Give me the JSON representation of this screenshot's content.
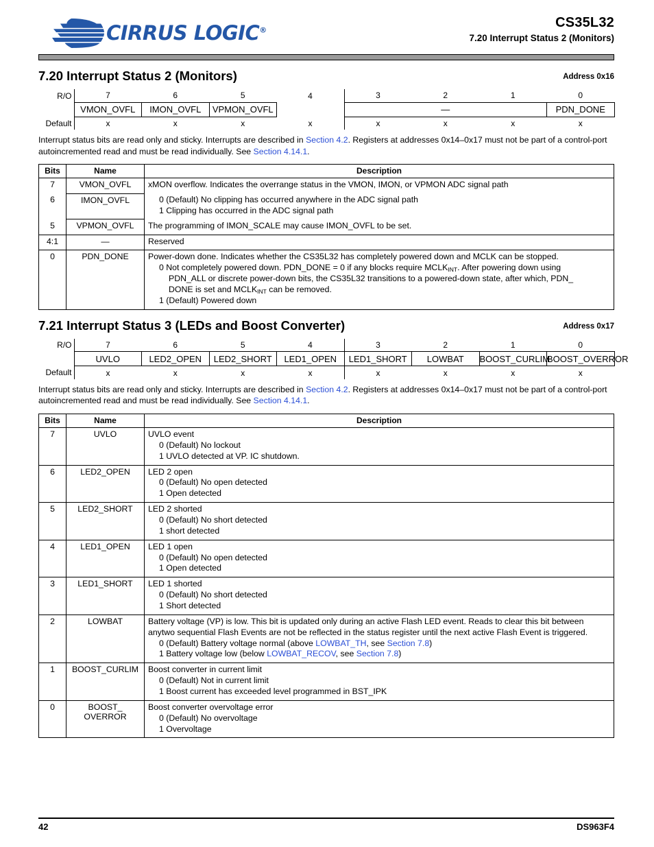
{
  "header": {
    "logo_text": "CIRRUS LOGIC",
    "logo_reg": "®",
    "part_number": "CS35L32",
    "subtitle": "7.20 Interrupt Status 2 (Monitors)",
    "logo_color": "#2457a7"
  },
  "footer": {
    "page_number": "42",
    "doc_number": "DS963F4"
  },
  "sections": [
    {
      "title": "7.20 Interrupt Status 2 (Monitors)",
      "address": "Address 0x16",
      "register": {
        "access_label": "R/O",
        "default_label": "Default",
        "bit_numbers": [
          "7",
          "6",
          "5",
          "4",
          "3",
          "2",
          "1",
          "0"
        ],
        "fields": [
          {
            "label": "VMON_OVFL",
            "span": 1,
            "bordered": true
          },
          {
            "label": "IMON_OVFL",
            "span": 1,
            "bordered": true
          },
          {
            "label": "VPMON_OVFL",
            "span": 1,
            "bordered": true
          },
          {
            "label": "",
            "span": 1,
            "bordered": false
          },
          {
            "label": "—",
            "span": 3,
            "bordered": true
          },
          {
            "label": "PDN_DONE",
            "span": 1,
            "bordered": true
          }
        ],
        "defaults": [
          "x",
          "x",
          "x",
          "x",
          "x",
          "x",
          "x",
          "x"
        ]
      },
      "note": {
        "part1": "Interrupt status bits are read only and sticky. Interrupts are described in ",
        "link1": "Section 4.2",
        "part2": ". Registers at addresses 0x14–0x17 must not be part of a control-port autoincremented read and must be read individually. See ",
        "link2": "Section 4.14.1",
        "part3": "."
      },
      "table": {
        "headers": [
          "Bits",
          "Name",
          "Description"
        ],
        "rows": [
          {
            "bits": "7",
            "name": "VMON_OVFL",
            "group": "start",
            "desc_lines": [
              {
                "text": "xMON overflow. Indicates the overrange status in the VMON, IMON, or VPMON ADC signal path",
                "indent": 0
              }
            ]
          },
          {
            "bits": "6",
            "name": "IMON_OVFL",
            "group": "mid",
            "desc_lines": [
              {
                "text": "0 (Default) No clipping has occurred anywhere in the ADC signal path",
                "indent": 1
              },
              {
                "text": "1 Clipping has occurred in the ADC signal path",
                "indent": 1
              }
            ]
          },
          {
            "bits": "5",
            "name": "VPMON_OVFL",
            "group": "end",
            "desc_lines": [
              {
                "text": "The programming of IMON_SCALE may cause IMON_OVFL to be set.",
                "indent": 0
              }
            ]
          },
          {
            "bits": "4:1",
            "name": "—",
            "group": "single",
            "desc_lines": [
              {
                "text": "Reserved",
                "indent": 0
              }
            ]
          },
          {
            "bits": "0",
            "name": "PDN_DONE",
            "group": "single",
            "desc_lines": [
              {
                "text": "Power-down done. Indicates whether the CS35L32 has completely powered down and MCLK can be stopped.",
                "indent": 0
              },
              {
                "html": "0 Not completely powered down. PDN_DONE = 0 if any blocks require MCLK<sub>INT</sub>. After powering down using",
                "indent": 1
              },
              {
                "html": "PDN_ALL or discrete power-down bits, the CS35L32 transitions to a powered-down state, after which, PDN_",
                "indent": 2
              },
              {
                "html": "DONE is set and MCLK<sub>INT</sub> can be removed.",
                "indent": 2
              },
              {
                "text": "1 (Default) Powered down",
                "indent": 1
              }
            ]
          }
        ]
      }
    },
    {
      "title": "7.21 Interrupt Status 3 (LEDs and Boost Converter)",
      "address": "Address 0x17",
      "register": {
        "access_label": "R/O",
        "default_label": "Default",
        "bit_numbers": [
          "7",
          "6",
          "5",
          "4",
          "3",
          "2",
          "1",
          "0"
        ],
        "fields": [
          {
            "label": "UVLO",
            "span": 1,
            "bordered": true
          },
          {
            "label": "LED2_OPEN",
            "span": 1,
            "bordered": true
          },
          {
            "label": "LED2_SHORT",
            "span": 1,
            "bordered": true
          },
          {
            "label": "LED1_OPEN",
            "span": 1,
            "bordered": true
          },
          {
            "label": "LED1_SHORT",
            "span": 1,
            "bordered": true
          },
          {
            "label": "LOWBAT",
            "span": 1,
            "bordered": true
          },
          {
            "label": "BOOST_CURLIM",
            "span": 1,
            "bordered": true
          },
          {
            "label": "BOOST_OVERROR",
            "span": 1,
            "bordered": true
          }
        ],
        "defaults": [
          "x",
          "x",
          "x",
          "x",
          "x",
          "x",
          "x",
          "x"
        ]
      },
      "note": {
        "part1": "Interrupt status bits are read only and sticky. Interrupts are described in ",
        "link1": "Section 4.2",
        "part2": ". Registers at addresses 0x14–0x17 must not be part of a control-port autoincremented read and must be read individually. See ",
        "link2": "Section 4.14.1",
        "part3": "."
      },
      "table": {
        "headers": [
          "Bits",
          "Name",
          "Description"
        ],
        "rows": [
          {
            "bits": "7",
            "name": "UVLO",
            "group": "single",
            "desc_lines": [
              {
                "text": "UVLO event",
                "indent": 0
              },
              {
                "text": "0 (Default) No lockout",
                "indent": 1
              },
              {
                "text": "1 UVLO detected at VP. IC shutdown.",
                "indent": 1
              }
            ]
          },
          {
            "bits": "6",
            "name": "LED2_OPEN",
            "group": "single",
            "desc_lines": [
              {
                "text": "LED 2 open",
                "indent": 0
              },
              {
                "text": "0 (Default) No open detected",
                "indent": 1
              },
              {
                "text": "1 Open detected",
                "indent": 1
              }
            ]
          },
          {
            "bits": "5",
            "name": "LED2_SHORT",
            "group": "single",
            "desc_lines": [
              {
                "text": "LED 2 shorted",
                "indent": 0
              },
              {
                "text": "0 (Default) No short detected",
                "indent": 1
              },
              {
                "text": "1 short detected",
                "indent": 1
              }
            ]
          },
          {
            "bits": "4",
            "name": "LED1_OPEN",
            "group": "single",
            "desc_lines": [
              {
                "text": "LED 1 open",
                "indent": 0
              },
              {
                "text": "0 (Default) No open detected",
                "indent": 1
              },
              {
                "text": "1 Open detected",
                "indent": 1
              }
            ]
          },
          {
            "bits": "3",
            "name": "LED1_SHORT",
            "group": "single",
            "desc_lines": [
              {
                "text": "LED 1 shorted",
                "indent": 0
              },
              {
                "text": "0 (Default) No short detected",
                "indent": 1
              },
              {
                "text": "1 Short detected",
                "indent": 1
              }
            ]
          },
          {
            "bits": "2",
            "name": "LOWBAT",
            "group": "single",
            "desc_lines": [
              {
                "text": "Battery voltage (VP) is low. This bit is updated only during an active Flash LED event. Reads to clear this bit between any",
                "indent": 0
              },
              {
                "text": "two sequential Flash Events are not be reflected in the status register until the next active Flash Event is triggered.",
                "indent": 0
              },
              {
                "html": "0 (Default) Battery voltage normal (above <span class=\"lnk\">LOWBAT_TH</span>, see <span class=\"lnk\">Section 7.8</span>)",
                "indent": 1
              },
              {
                "html": "1 Battery voltage low (below <span class=\"lnk\">LOWBAT_RECOV</span>, see <span class=\"lnk\">Section 7.8</span>)",
                "indent": 1
              }
            ]
          },
          {
            "bits": "1",
            "name": "BOOST_CURLIM",
            "group": "single",
            "desc_lines": [
              {
                "text": "Boost converter in current limit",
                "indent": 0
              },
              {
                "text": "0 (Default) Not in current limit",
                "indent": 1
              },
              {
                "text": "1 Boost current has exceeded level programmed in BST_IPK",
                "indent": 1
              }
            ]
          },
          {
            "bits": "0",
            "name": "BOOST_ OVERROR",
            "name_lines": [
              "BOOST_",
              "OVERROR"
            ],
            "group": "single",
            "desc_lines": [
              {
                "text": "Boost converter overvoltage error",
                "indent": 0
              },
              {
                "text": "0 (Default) No overvoltage",
                "indent": 1
              },
              {
                "text": "1 Overvoltage",
                "indent": 1
              }
            ]
          }
        ]
      }
    }
  ]
}
